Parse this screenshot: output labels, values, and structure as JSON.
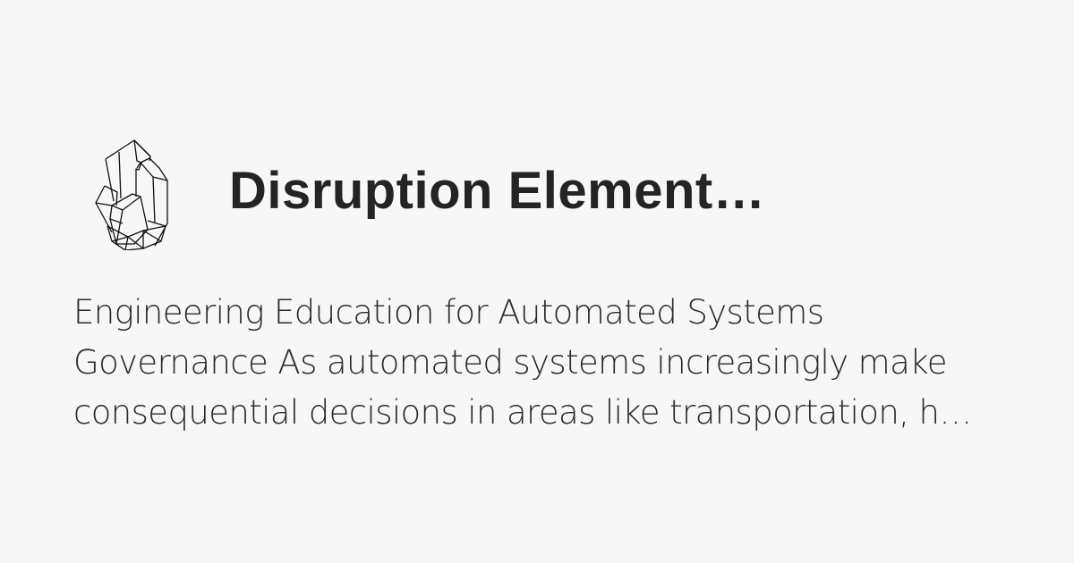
{
  "logo": {
    "icon": "crystal-icon"
  },
  "title": "Disruption Element…",
  "description": {
    "lines": [
      "Engineering Education for Automated Systems",
      "Governance As automated systems increasingly make",
      "consequential decisions in areas like transportation, h…"
    ]
  }
}
